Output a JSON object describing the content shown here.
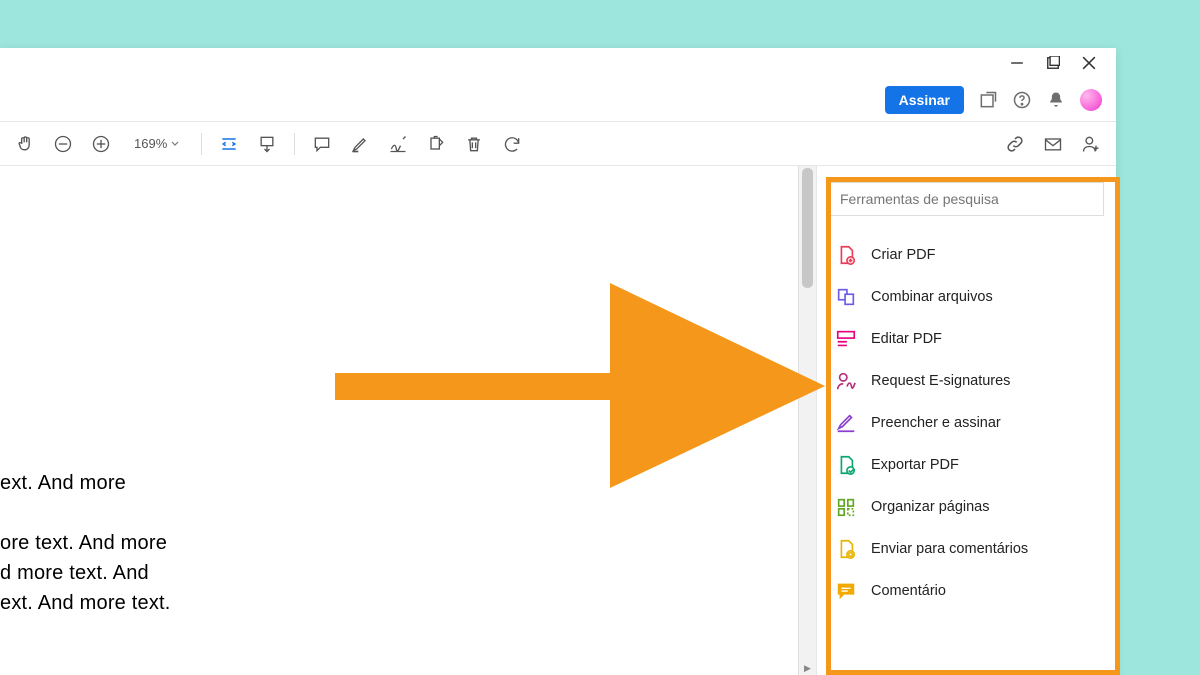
{
  "zoom_level": "169%",
  "sign_button": "Assinar",
  "search_placeholder": "Ferramentas de pesquisa",
  "tools": {
    "create": "Criar PDF",
    "combine": "Combinar arquivos",
    "edit": "Editar PDF",
    "request_sign": "Request E-signatures",
    "fill_sign": "Preencher e assinar",
    "export": "Exportar PDF",
    "organize": "Organizar páginas",
    "send_comments": "Enviar para comentários",
    "comment": "Comentário"
  },
  "doc_line1": "ext. And more",
  "doc_line2": "ore text. And more",
  "doc_line3": "d more text. And",
  "doc_line4": "ext. And more text."
}
